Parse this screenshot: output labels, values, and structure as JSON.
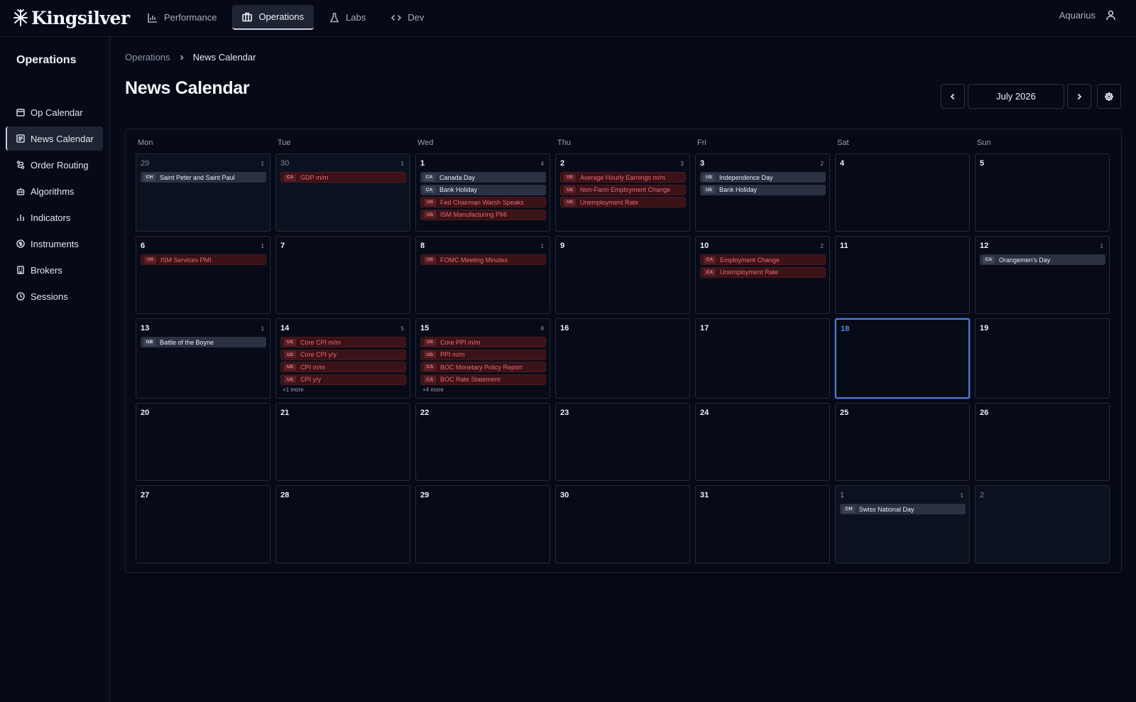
{
  "app": {
    "name": "Kingsilver",
    "user": "Aquarius"
  },
  "nav": [
    {
      "label": "Performance",
      "icon": "bar-chart-icon",
      "active": false
    },
    {
      "label": "Operations",
      "icon": "briefcase-icon",
      "active": true
    },
    {
      "label": "Labs",
      "icon": "flask-icon",
      "active": false
    },
    {
      "label": "Dev",
      "icon": "code-icon",
      "active": false
    }
  ],
  "sidebar": {
    "title": "Operations",
    "items": [
      {
        "label": "Op Calendar",
        "icon": "calendar-icon",
        "active": false
      },
      {
        "label": "News Calendar",
        "icon": "newspaper-icon",
        "active": true
      },
      {
        "label": "Order Routing",
        "icon": "route-icon",
        "active": false
      },
      {
        "label": "Algorithms",
        "icon": "bot-icon",
        "active": false
      },
      {
        "label": "Indicators",
        "icon": "indicator-chart-icon",
        "active": false
      },
      {
        "label": "Instruments",
        "icon": "coin-icon",
        "active": false
      },
      {
        "label": "Brokers",
        "icon": "building-icon",
        "active": false
      },
      {
        "label": "Sessions",
        "icon": "clock-icon",
        "active": false
      }
    ]
  },
  "breadcrumb": {
    "parent": "Operations",
    "current": "News Calendar"
  },
  "page": {
    "title": "News Calendar",
    "month": "July 2026"
  },
  "colors": {
    "accent": "#4d78d8",
    "high_impact": "#ec6a6f",
    "background": "#060a16"
  },
  "calendar": {
    "weekdays": [
      "Mon",
      "Tue",
      "Wed",
      "Thu",
      "Fri",
      "Sat",
      "Sun"
    ],
    "weeks": [
      [
        {
          "day": "29",
          "outside": true,
          "count": "1",
          "events": [
            {
              "tag": "CH",
              "title": "Saint Peter and Saint Paul",
              "impact": "neutral"
            }
          ]
        },
        {
          "day": "30",
          "outside": true,
          "count": "1",
          "events": [
            {
              "tag": "CA",
              "title": "GDP m/m",
              "impact": "high"
            }
          ]
        },
        {
          "day": "1",
          "outside": false,
          "count": "4",
          "events": [
            {
              "tag": "CA",
              "title": "Canada Day",
              "impact": "neutral"
            },
            {
              "tag": "CA",
              "title": "Bank Holiday",
              "impact": "neutral"
            },
            {
              "tag": "US",
              "title": "Fed Chairman Warsh Speaks",
              "impact": "high"
            },
            {
              "tag": "US",
              "title": "ISM Manufacturing PMI",
              "impact": "high"
            }
          ]
        },
        {
          "day": "2",
          "outside": false,
          "count": "3",
          "events": [
            {
              "tag": "US",
              "title": "Average Hourly Earnings m/m",
              "impact": "high"
            },
            {
              "tag": "US",
              "title": "Non-Farm Employment Change",
              "impact": "high"
            },
            {
              "tag": "US",
              "title": "Unemployment Rate",
              "impact": "high"
            }
          ]
        },
        {
          "day": "3",
          "outside": false,
          "count": "2",
          "events": [
            {
              "tag": "US",
              "title": "Independence Day",
              "impact": "neutral"
            },
            {
              "tag": "US",
              "title": "Bank Holiday",
              "impact": "neutral"
            }
          ]
        },
        {
          "day": "4",
          "outside": false,
          "count": "",
          "events": []
        },
        {
          "day": "5",
          "outside": false,
          "count": "",
          "events": []
        }
      ],
      [
        {
          "day": "6",
          "outside": false,
          "count": "1",
          "events": [
            {
              "tag": "US",
              "title": "ISM Services PMI",
              "impact": "high"
            }
          ]
        },
        {
          "day": "7",
          "outside": false,
          "count": "",
          "events": []
        },
        {
          "day": "8",
          "outside": false,
          "count": "1",
          "events": [
            {
              "tag": "US",
              "title": "FOMC Meeting Minutes",
              "impact": "high"
            }
          ]
        },
        {
          "day": "9",
          "outside": false,
          "count": "",
          "events": []
        },
        {
          "day": "10",
          "outside": false,
          "count": "2",
          "events": [
            {
              "tag": "CA",
              "title": "Employment Change",
              "impact": "high"
            },
            {
              "tag": "CA",
              "title": "Unemployment Rate",
              "impact": "high"
            }
          ]
        },
        {
          "day": "11",
          "outside": false,
          "count": "",
          "events": []
        },
        {
          "day": "12",
          "outside": false,
          "count": "1",
          "events": [
            {
              "tag": "CA",
              "title": "Orangemen's Day",
              "impact": "neutral"
            }
          ]
        }
      ],
      [
        {
          "day": "13",
          "outside": false,
          "count": "1",
          "events": [
            {
              "tag": "GB",
              "title": "Battle of the Boyne",
              "impact": "neutral"
            }
          ]
        },
        {
          "day": "14",
          "outside": false,
          "count": "5",
          "more": "+1 more",
          "events": [
            {
              "tag": "US",
              "title": "Core CPI m/m",
              "impact": "high"
            },
            {
              "tag": "US",
              "title": "Core CPI y/y",
              "impact": "high"
            },
            {
              "tag": "US",
              "title": "CPI m/m",
              "impact": "high"
            },
            {
              "tag": "US",
              "title": "CPI y/y",
              "impact": "high"
            }
          ]
        },
        {
          "day": "15",
          "outside": false,
          "count": "8",
          "more": "+4 more",
          "events": [
            {
              "tag": "US",
              "title": "Core PPI m/m",
              "impact": "high"
            },
            {
              "tag": "US",
              "title": "PPI m/m",
              "impact": "high"
            },
            {
              "tag": "CA",
              "title": "BOC Monetary Policy Report",
              "impact": "high"
            },
            {
              "tag": "CA",
              "title": "BOC Rate Statement",
              "impact": "high"
            }
          ]
        },
        {
          "day": "16",
          "outside": false,
          "count": "",
          "events": []
        },
        {
          "day": "17",
          "outside": false,
          "count": "",
          "events": []
        },
        {
          "day": "18",
          "outside": false,
          "today": true,
          "count": "",
          "events": []
        },
        {
          "day": "19",
          "outside": false,
          "count": "",
          "events": []
        }
      ],
      [
        {
          "day": "20",
          "outside": false,
          "count": "",
          "events": []
        },
        {
          "day": "21",
          "outside": false,
          "count": "",
          "events": []
        },
        {
          "day": "22",
          "outside": false,
          "count": "",
          "events": []
        },
        {
          "day": "23",
          "outside": false,
          "count": "",
          "events": []
        },
        {
          "day": "24",
          "outside": false,
          "count": "",
          "events": []
        },
        {
          "day": "25",
          "outside": false,
          "count": "",
          "events": []
        },
        {
          "day": "26",
          "outside": false,
          "count": "",
          "events": []
        }
      ],
      [
        {
          "day": "27",
          "outside": false,
          "count": "",
          "events": []
        },
        {
          "day": "28",
          "outside": false,
          "count": "",
          "events": []
        },
        {
          "day": "29",
          "outside": false,
          "count": "",
          "events": []
        },
        {
          "day": "30",
          "outside": false,
          "count": "",
          "events": []
        },
        {
          "day": "31",
          "outside": false,
          "count": "",
          "events": []
        },
        {
          "day": "1",
          "outside": true,
          "count": "1",
          "events": [
            {
              "tag": "CH",
              "title": "Swiss National Day",
              "impact": "neutral"
            }
          ]
        },
        {
          "day": "2",
          "outside": true,
          "count": "",
          "events": []
        }
      ]
    ]
  }
}
